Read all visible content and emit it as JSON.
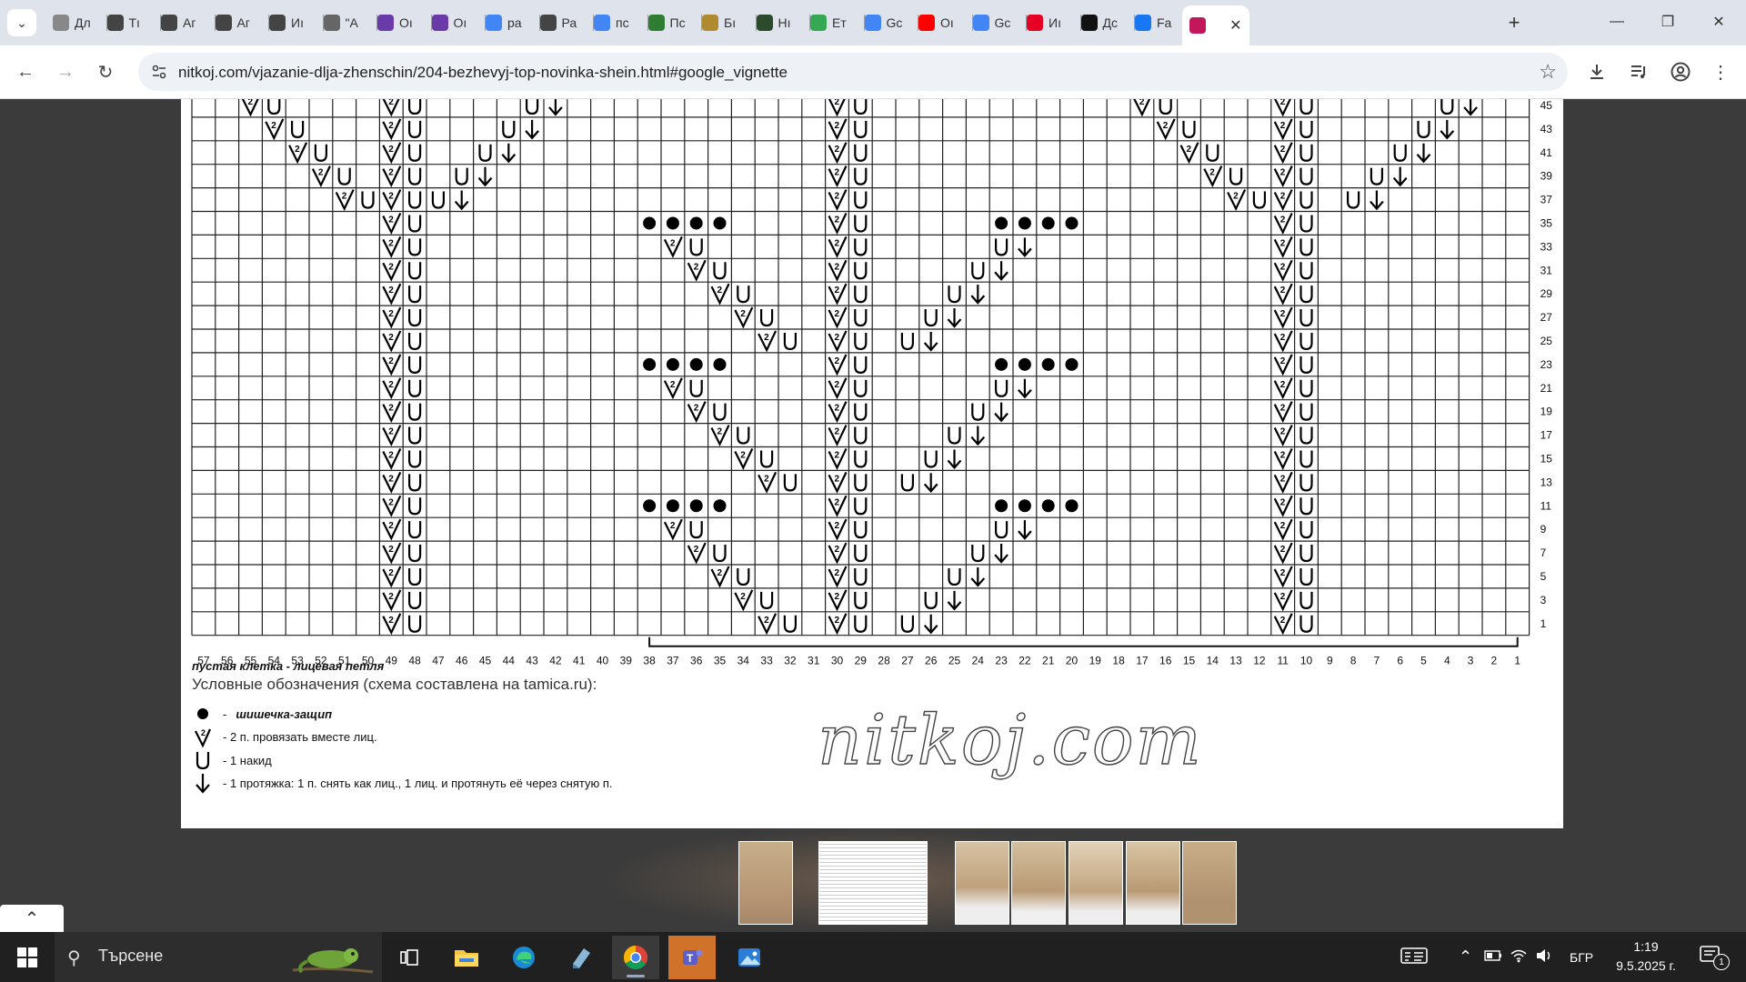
{
  "browser": {
    "tabs": [
      {
        "label": "Дл",
        "favicon": "sheep-icon",
        "color": "#888"
      },
      {
        "label": "Тı",
        "favicon": "globe-icon",
        "color": "#444"
      },
      {
        "label": "Аг",
        "favicon": "globe-icon",
        "color": "#444"
      },
      {
        "label": "Аг",
        "favicon": "globe-icon",
        "color": "#444"
      },
      {
        "label": "Иı",
        "favicon": "globe-icon",
        "color": "#444"
      },
      {
        "label": "\"А",
        "favicon": "knit-icon",
        "color": "#666"
      },
      {
        "label": "Оı",
        "favicon": "purple-logo-icon",
        "color": "#6a3aa8"
      },
      {
        "label": "Оı",
        "favicon": "purple-logo-icon",
        "color": "#6a3aa8"
      },
      {
        "label": "ра",
        "favicon": "google-icon",
        "color": "#4285f4"
      },
      {
        "label": "Ра",
        "favicon": "globe-icon",
        "color": "#444"
      },
      {
        "label": "пс",
        "favicon": "google-icon",
        "color": "#4285f4"
      },
      {
        "label": "Пс",
        "favicon": "number2-icon",
        "color": "#2e7d32"
      },
      {
        "label": "Бı",
        "favicon": "crest-icon",
        "color": "#b08a2e"
      },
      {
        "label": "Нı",
        "favicon": "photo-icon",
        "color": "#2c4a2c"
      },
      {
        "label": "Ет",
        "favicon": "maps-pin-icon",
        "color": "#34a853"
      },
      {
        "label": "Gс",
        "favicon": "google-icon",
        "color": "#4285f4"
      },
      {
        "label": "Оı",
        "favicon": "youtube-icon",
        "color": "#ff0000"
      },
      {
        "label": "Gс",
        "favicon": "google-icon",
        "color": "#4285f4"
      },
      {
        "label": "Иı",
        "favicon": "pinterest-icon",
        "color": "#e60023"
      },
      {
        "label": "Дс",
        "favicon": "amazon-icon",
        "color": "#111"
      },
      {
        "label": "Fa",
        "favicon": "facebook-icon",
        "color": "#1877f2"
      },
      {
        "label": "",
        "favicon": "yarn-icon",
        "color": "#c2185b",
        "active": true
      }
    ],
    "url": "nitkoj.com/vjazanie-dlja-zhenschin/204-bezhevyj-top-novinka-shein.html#google_vignette"
  },
  "chart": {
    "row_numbers": [
      "45",
      "43",
      "41",
      "39",
      "37",
      "35",
      "33",
      "31",
      "29",
      "27",
      "25",
      "23",
      "21",
      "19",
      "17",
      "15",
      "13",
      "11",
      "9",
      "7",
      "5",
      "3",
      "1"
    ],
    "column_numbers": [
      "57",
      "56",
      "55",
      "54",
      "53",
      "52",
      "51",
      "50",
      "49",
      "48",
      "47",
      "46",
      "45",
      "44",
      "43",
      "42",
      "41",
      "40",
      "39",
      "38",
      "37",
      "36",
      "35",
      "34",
      "33",
      "32",
      "31",
      "30",
      "29",
      "28",
      "27",
      "26",
      "25",
      "24",
      "23",
      "22",
      "21",
      "20",
      "19",
      "18",
      "17",
      "16",
      "15",
      "14",
      "13",
      "12",
      "11",
      "10",
      "9",
      "8",
      "7",
      "6",
      "5",
      "4",
      "3",
      "2",
      "1"
    ],
    "empty_cell_note": "пустая клетка - лицевая петля"
  },
  "legend": {
    "title": "Условные обозначения (схема составлена на tamica.ru):",
    "items": [
      {
        "text": "шишечка-защип",
        "symbol": "bobble"
      },
      {
        "text": "- 2 п. провязать вместе лиц.",
        "symbol": "k2tog"
      },
      {
        "text": "- 1 накид",
        "symbol": "yo"
      },
      {
        "text": "- 1 протяжка: 1 п. снять как лиц., 1 лиц. и протянуть её через снятую п.",
        "symbol": "skpo"
      }
    ]
  },
  "watermark": "nitkoj.com",
  "taskbar": {
    "search_placeholder": "Търсене",
    "language": "БГР",
    "time": "1:19",
    "date": "9.5.2025 г.",
    "notification_count": "1"
  }
}
